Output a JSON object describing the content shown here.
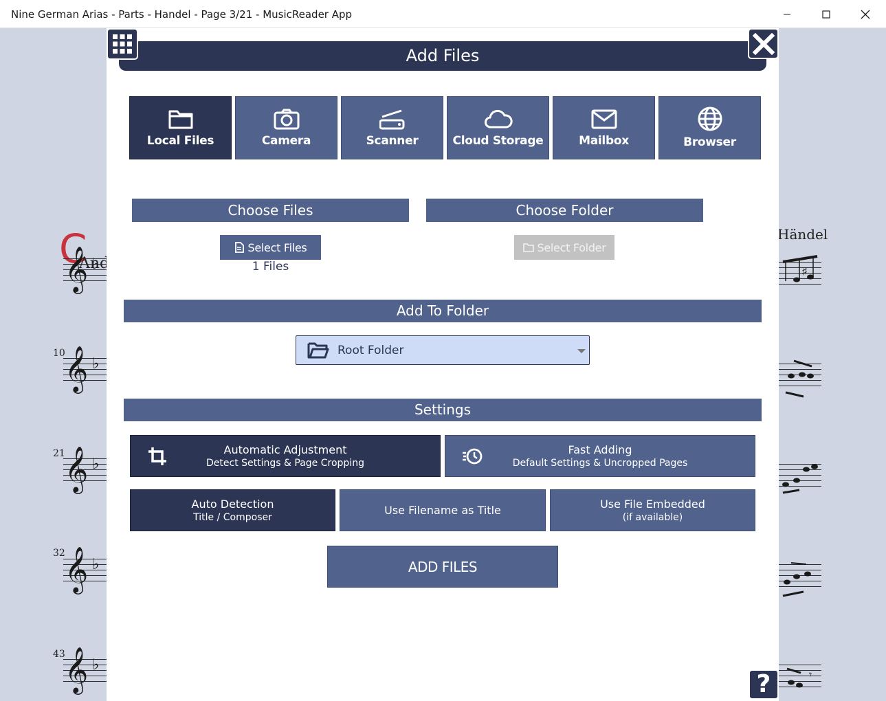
{
  "window": {
    "title": "Nine German Arias - Parts - Handel - Page 3/21 - MusicReader App"
  },
  "sheet": {
    "tempo_letter": "C",
    "tempo_text": "And",
    "composer": "Händel",
    "measure_numbers": [
      "10",
      "21",
      "32",
      "43"
    ]
  },
  "dialog": {
    "title": "Add Files",
    "sources": [
      {
        "label": "Local Files",
        "icon": "folder-icon",
        "active": true
      },
      {
        "label": "Camera",
        "icon": "camera-icon",
        "active": false
      },
      {
        "label": "Scanner",
        "icon": "scanner-icon",
        "active": false
      },
      {
        "label": "Cloud Storage",
        "icon": "cloud-icon",
        "active": false
      },
      {
        "label": "Mailbox",
        "icon": "mail-icon",
        "active": false
      },
      {
        "label": "Browser",
        "icon": "globe-icon",
        "active": false
      }
    ],
    "choose_files": {
      "header": "Choose Files",
      "button": "Select Files",
      "count": "1 Files"
    },
    "choose_folder": {
      "header": "Choose Folder",
      "button": "Select Folder"
    },
    "add_to_folder": {
      "header": "Add To Folder",
      "selected": "Root Folder"
    },
    "settings": {
      "header": "Settings",
      "auto_adjust": {
        "title": "Automatic Adjustment",
        "subtitle": "Detect Settings & Page Cropping"
      },
      "fast_adding": {
        "title": "Fast Adding",
        "subtitle": "Default Settings & Uncropped Pages"
      },
      "auto_detect": {
        "title": "Auto Detection",
        "subtitle": "Title / Composer"
      },
      "filename_title": {
        "title": "Use Filename as Title"
      },
      "embedded": {
        "title": "Use File Embedded",
        "subtitle": "(if available)"
      }
    },
    "add_button": "ADD FILES",
    "help": "?"
  },
  "colors": {
    "dark_navy": "#2c3654",
    "slate_blue": "#51628d",
    "select_bg": "#cfdcf7",
    "accent_red": "#c8323c"
  }
}
